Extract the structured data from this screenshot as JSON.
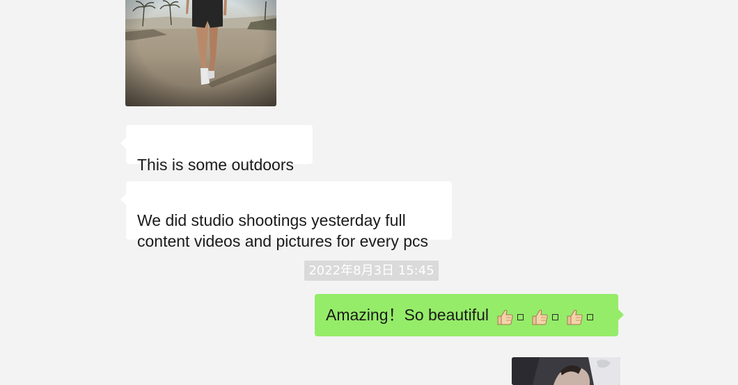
{
  "messages": [
    {
      "id": "photo-top",
      "type": "image",
      "side": "incoming",
      "description": "woman walking outdoors"
    },
    {
      "id": "msg-1",
      "type": "text",
      "side": "incoming",
      "text": "This is some outdoors"
    },
    {
      "id": "msg-2",
      "type": "text",
      "side": "incoming",
      "text": "We did studio shootings yesterday full\ncontent videos and pictures for every pcs"
    },
    {
      "id": "timestamp",
      "type": "timestamp",
      "text": "2022年8月3日 15:45"
    },
    {
      "id": "msg-3",
      "type": "text",
      "side": "outgoing",
      "text": "Amazing！So beautiful",
      "emoji": [
        "thumbs-up-icon",
        "missing-glyph-icon",
        "thumbs-up-icon",
        "missing-glyph-icon",
        "thumbs-up-icon",
        "missing-glyph-icon"
      ]
    },
    {
      "id": "photo-bottom",
      "type": "image",
      "side": "outgoing",
      "description": "studio photo"
    }
  ],
  "colors": {
    "background": "#f3f3f3",
    "incoming_bubble": "#ffffff",
    "outgoing_bubble": "#95ec69",
    "timestamp_bg": "#dadada",
    "timestamp_text": "#ffffff"
  }
}
